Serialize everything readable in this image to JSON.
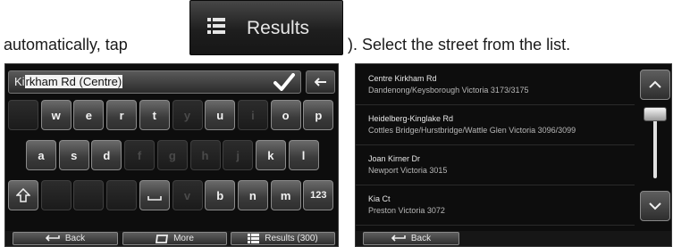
{
  "instruction": {
    "before": "automatically, tap",
    "after": "). Select the street from the list."
  },
  "results_button": {
    "label": "Results",
    "icon": "list-icon"
  },
  "keyboard_screen": {
    "search": {
      "typed": "Ki",
      "suggestion": "rkham Rd (Centre)"
    },
    "rows": [
      [
        {
          "label": "",
          "enabled": false
        },
        {
          "label": "w",
          "enabled": true
        },
        {
          "label": "e",
          "enabled": true
        },
        {
          "label": "r",
          "enabled": true
        },
        {
          "label": "t",
          "enabled": true
        },
        {
          "label": "y",
          "enabled": false
        },
        {
          "label": "u",
          "enabled": true
        },
        {
          "label": "i",
          "enabled": false
        },
        {
          "label": "o",
          "enabled": true
        },
        {
          "label": "p",
          "enabled": true
        }
      ],
      [
        {
          "label": "a",
          "enabled": true
        },
        {
          "label": "s",
          "enabled": true
        },
        {
          "label": "d",
          "enabled": true
        },
        {
          "label": "f",
          "enabled": false
        },
        {
          "label": "g",
          "enabled": false
        },
        {
          "label": "h",
          "enabled": false
        },
        {
          "label": "j",
          "enabled": false
        },
        {
          "label": "k",
          "enabled": true
        },
        {
          "label": "l",
          "enabled": true
        }
      ],
      [
        {
          "label": "shift",
          "enabled": true
        },
        {
          "label": "",
          "enabled": false
        },
        {
          "label": "",
          "enabled": false
        },
        {
          "label": "",
          "enabled": false
        },
        {
          "label": "space",
          "enabled": true
        },
        {
          "label": "v",
          "enabled": false
        },
        {
          "label": "b",
          "enabled": true
        },
        {
          "label": "n",
          "enabled": true
        },
        {
          "label": "m",
          "enabled": true
        },
        {
          "label": "123",
          "enabled": true
        }
      ]
    ],
    "bottom": {
      "back_label": "Back",
      "more_label": "More",
      "results_label": "Results (300)"
    }
  },
  "results_screen": {
    "items": [
      {
        "name": "Centre Kirkham Rd",
        "place": "Dandenong/Keysborough Victoria 3173/3175"
      },
      {
        "name": "Heidelberg-Kinglake Rd",
        "place": "Cottles Bridge/Hurstbridge/Wattle Glen Victoria 3096/3099"
      },
      {
        "name": "Joan Kirner Dr",
        "place": "Newport Victoria 3015"
      },
      {
        "name": "Kia Ct",
        "place": "Preston Victoria 3072"
      }
    ],
    "scroll_position": 0.1,
    "bottom": {
      "back_label": "Back"
    }
  }
}
